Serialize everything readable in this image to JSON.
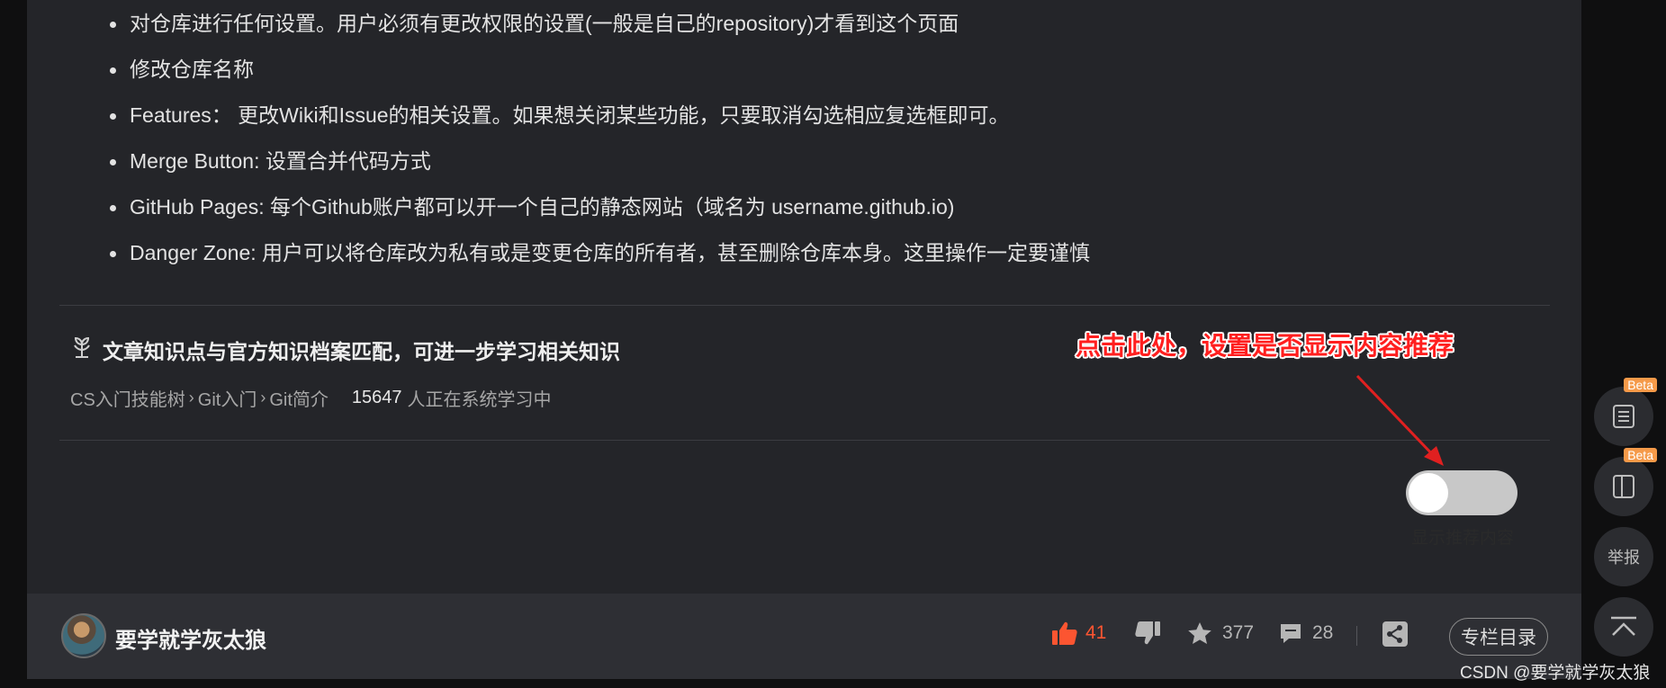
{
  "article": {
    "bullets": [
      "对仓库进行任何设置。用户必须有更改权限的设置(一般是自己的repository)才看到这个页面",
      "修改仓库名称",
      "Features： 更改Wiki和Issue的相关设置。如果想关闭某些功能，只要取消勾选相应复选框即可。",
      "Merge Button: 设置合并代码方式",
      "GitHub Pages: 每个Github账户都可以开一个自己的静态网站（域名为 username.github.io)",
      "Danger Zone: 用户可以将仓库改为私有或是变更仓库的所有者，甚至删除仓库本身。这里操作一定要谨慎"
    ]
  },
  "knowledge": {
    "title": "文章知识点与官方知识档案匹配，可进一步学习相关知识",
    "path": [
      "CS入门技能树",
      "Git入门",
      "Git简介"
    ],
    "learner_count": "15647",
    "learner_label": "人正在系统学习中"
  },
  "annotation": {
    "text": "点击此处，设置是否显示内容推荐",
    "color": "#ff1f1f"
  },
  "toggle": {
    "label": "显示推荐内容",
    "checked": false
  },
  "footer": {
    "author": "要学就学灰太狼",
    "likes": "41",
    "favorites": "377",
    "comments": "28",
    "column_button": "专栏目录"
  },
  "sidebar": {
    "beta_badge": "Beta",
    "report_label": "举报"
  },
  "watermark": "CSDN @要学就学灰太狼",
  "colors": {
    "accent_like": "#fc5531",
    "beta_badge": "#f59a49",
    "background": "#242529"
  }
}
